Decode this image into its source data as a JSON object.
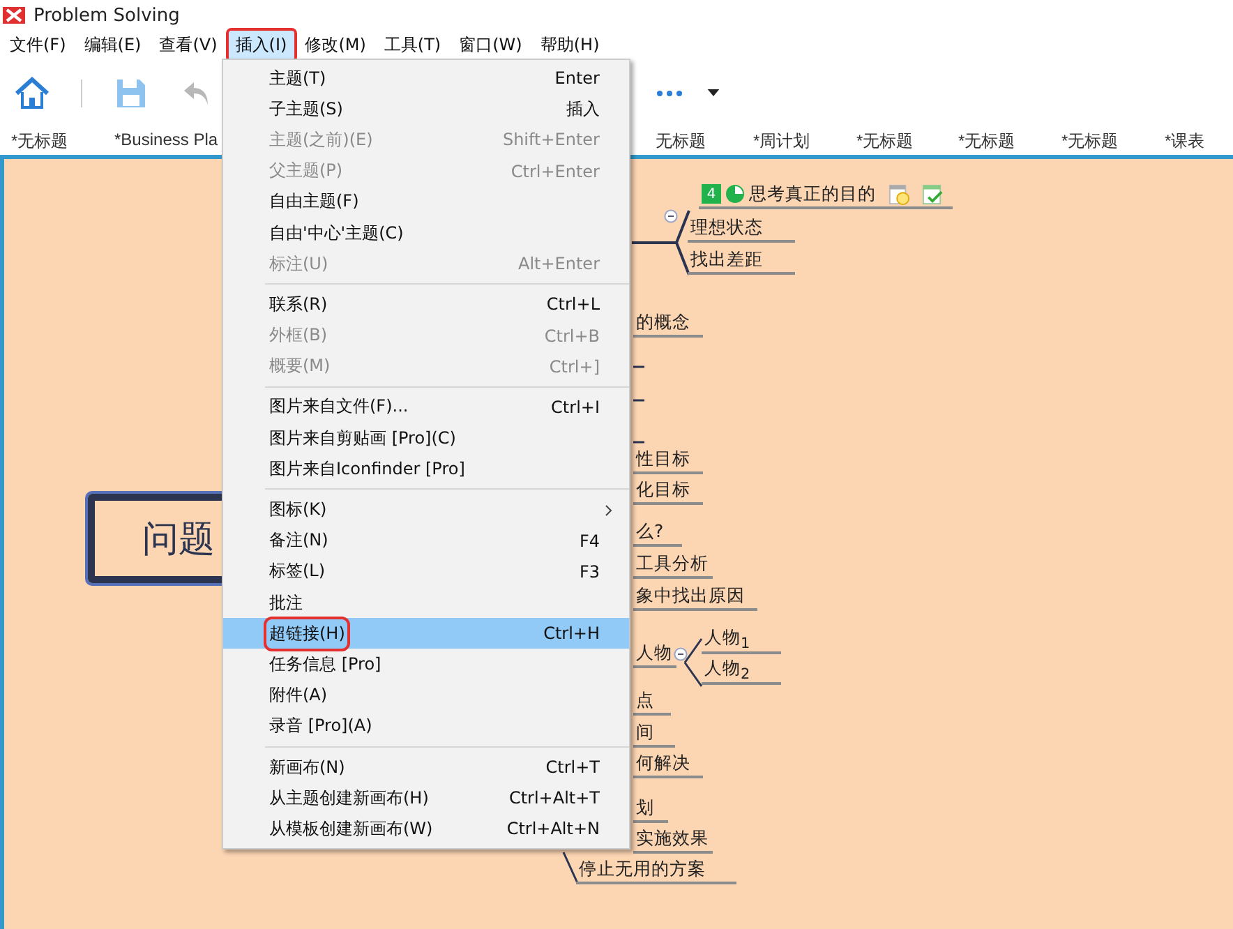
{
  "window": {
    "title": "Problem Solving"
  },
  "menubar": [
    {
      "label": "文件(F)",
      "selected": false,
      "annotated": false
    },
    {
      "label": "编辑(E)",
      "selected": false,
      "annotated": false
    },
    {
      "label": "查看(V)",
      "selected": false,
      "annotated": false
    },
    {
      "label": "插入(I)",
      "selected": true,
      "annotated": true
    },
    {
      "label": "修改(M)",
      "selected": false,
      "annotated": false
    },
    {
      "label": "工具(T)",
      "selected": false,
      "annotated": false
    },
    {
      "label": "窗口(W)",
      "selected": false,
      "annotated": false
    },
    {
      "label": "帮助(H)",
      "selected": false,
      "annotated": false
    }
  ],
  "tabs": [
    {
      "label": "*无标题",
      "selected": false
    },
    {
      "label": "*Business Pla",
      "selected": false
    },
    {
      "label": "无标题",
      "selected": false
    },
    {
      "label": "*周计划",
      "selected": false
    },
    {
      "label": "*无标题",
      "selected": false
    },
    {
      "label": "*无标题",
      "selected": false
    },
    {
      "label": "*无标题",
      "selected": false
    },
    {
      "label": "*课表",
      "selected": false
    }
  ],
  "canvas": {
    "central_topic": "问题",
    "topics": [
      {
        "label": "思考真正的目的",
        "badge": "4"
      },
      {
        "label": "理想状态"
      },
      {
        "label": "找出差距"
      },
      {
        "label": "的概念"
      },
      {
        "label": "性目标"
      },
      {
        "label": "化目标"
      },
      {
        "label": "么?"
      },
      {
        "label": "工具分析"
      },
      {
        "label": "象中找出原因"
      },
      {
        "label": "人物"
      },
      {
        "label": "人物$_{1}$"
      },
      {
        "label": "人物$_{2}$"
      },
      {
        "label": "点"
      },
      {
        "label": "间"
      },
      {
        "label": "何解决"
      },
      {
        "label": "划"
      },
      {
        "label": "实施效果"
      },
      {
        "label": "停止无用的方案"
      }
    ]
  },
  "menu": [
    {
      "kind": "item",
      "label": "主题(T)",
      "shortcut": "Enter",
      "disabled": false,
      "selected": false,
      "annotated": false
    },
    {
      "kind": "item",
      "label": "子主题(S)",
      "shortcut": "插入",
      "disabled": false,
      "selected": false,
      "annotated": false
    },
    {
      "kind": "item",
      "label": "主题(之前)(E)",
      "shortcut": "Shift+Enter",
      "disabled": true,
      "selected": false,
      "annotated": false
    },
    {
      "kind": "item",
      "label": "父主题(P)",
      "shortcut": "Ctrl+Enter",
      "disabled": true,
      "selected": false,
      "annotated": false
    },
    {
      "kind": "item",
      "label": "自由主题(F)",
      "disabled": false,
      "selected": false,
      "annotated": false
    },
    {
      "kind": "item",
      "label": "自由'中心'主题(C)",
      "disabled": false,
      "selected": false,
      "annotated": false
    },
    {
      "kind": "item",
      "label": "标注(U)",
      "shortcut": "Alt+Enter",
      "disabled": true,
      "selected": false,
      "annotated": false
    },
    {
      "kind": "separator"
    },
    {
      "kind": "item",
      "label": "联系(R)",
      "shortcut": "Ctrl+L",
      "disabled": false,
      "selected": false,
      "annotated": false
    },
    {
      "kind": "item",
      "label": "外框(B)",
      "shortcut": "Ctrl+B",
      "disabled": true,
      "selected": false,
      "annotated": false
    },
    {
      "kind": "item",
      "label": "概要(M)",
      "shortcut": "Ctrl+]",
      "disabled": true,
      "selected": false,
      "annotated": false
    },
    {
      "kind": "separator"
    },
    {
      "kind": "item",
      "label": "图片来自文件(F)...",
      "shortcut": "Ctrl+I",
      "disabled": false,
      "selected": false,
      "annotated": false
    },
    {
      "kind": "item",
      "label": "图片来自剪贴画 [Pro](C)",
      "disabled": false,
      "selected": false,
      "annotated": false
    },
    {
      "kind": "item",
      "label": "图片来自Iconfinder [Pro]",
      "disabled": false,
      "selected": false,
      "annotated": false
    },
    {
      "kind": "separator"
    },
    {
      "kind": "submenu",
      "label": "图标(K)",
      "disabled": false,
      "selected": false,
      "annotated": false
    },
    {
      "kind": "item",
      "label": "备注(N)",
      "shortcut": "F4",
      "disabled": false,
      "selected": false,
      "annotated": false
    },
    {
      "kind": "item",
      "label": "标签(L)",
      "shortcut": "F3",
      "disabled": false,
      "selected": false,
      "annotated": false
    },
    {
      "kind": "item",
      "label": "批注",
      "disabled": false,
      "selected": false,
      "annotated": false
    },
    {
      "kind": "item",
      "label": "超链接(H)",
      "shortcut": "Ctrl+H",
      "disabled": false,
      "selected": true,
      "annotated": true
    },
    {
      "kind": "item",
      "label": "任务信息 [Pro]",
      "disabled": false,
      "selected": false,
      "annotated": false
    },
    {
      "kind": "item",
      "label": "附件(A)",
      "disabled": false,
      "selected": false,
      "annotated": false
    },
    {
      "kind": "item",
      "label": "录音 [Pro](A)",
      "disabled": false,
      "selected": false,
      "annotated": false
    },
    {
      "kind": "separator"
    },
    {
      "kind": "item",
      "label": "新画布(N)",
      "shortcut": "Ctrl+T",
      "disabled": false,
      "selected": false,
      "annotated": false
    },
    {
      "kind": "item",
      "label": "从主题创建新画布(H)",
      "shortcut": "Ctrl+Alt+T",
      "disabled": false,
      "selected": false,
      "annotated": false
    },
    {
      "kind": "item",
      "label": "从模板创建新画布(W)",
      "shortcut": "Ctrl+Alt+N",
      "disabled": false,
      "selected": false,
      "annotated": false
    }
  ]
}
